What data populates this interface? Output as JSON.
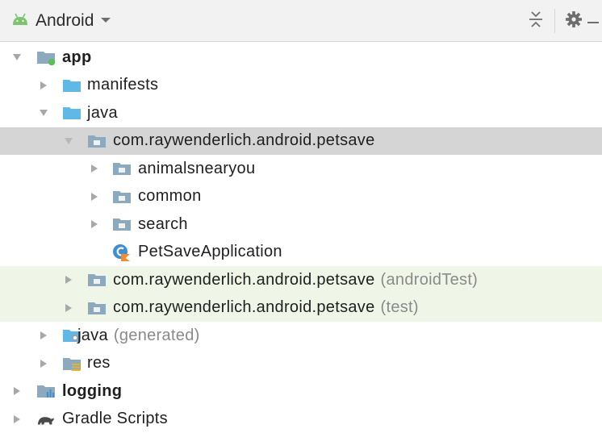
{
  "toolbar": {
    "view_label": "Android"
  },
  "tree": {
    "app": "app",
    "manifests": "manifests",
    "java": "java",
    "pkg_main": "com.raywenderlich.android.petsave",
    "animalsnearyou": "animalsnearyou",
    "common": "common",
    "search": "search",
    "petsave_application": "PetSaveApplication",
    "pkg_android_test": "com.raywenderlich.android.petsave",
    "pkg_android_test_suffix": "(androidTest)",
    "pkg_test": "com.raywenderlich.android.petsave",
    "pkg_test_suffix": "(test)",
    "java_generated": "java",
    "java_generated_suffix": "(generated)",
    "res": "res",
    "logging": "logging",
    "gradle_scripts": "Gradle Scripts"
  },
  "icons": {
    "android": "android-icon",
    "dropdown": "chevron-down-icon",
    "collapse_all": "collapse-all-icon",
    "settings": "gear-icon",
    "hide": "minus-icon",
    "folder": "folder-icon",
    "package": "package-icon",
    "module": "module-icon",
    "kotlin_class": "kotlin-class-icon",
    "gradle": "gradle-icon"
  },
  "colors": {
    "selection": "#d5d5d5",
    "test_background": "#eff6e8",
    "folder_blue": "#5fb8e6",
    "module_green": "#59c15a",
    "android_green": "#7cc46e",
    "secondary_text": "#8a8a8a"
  }
}
